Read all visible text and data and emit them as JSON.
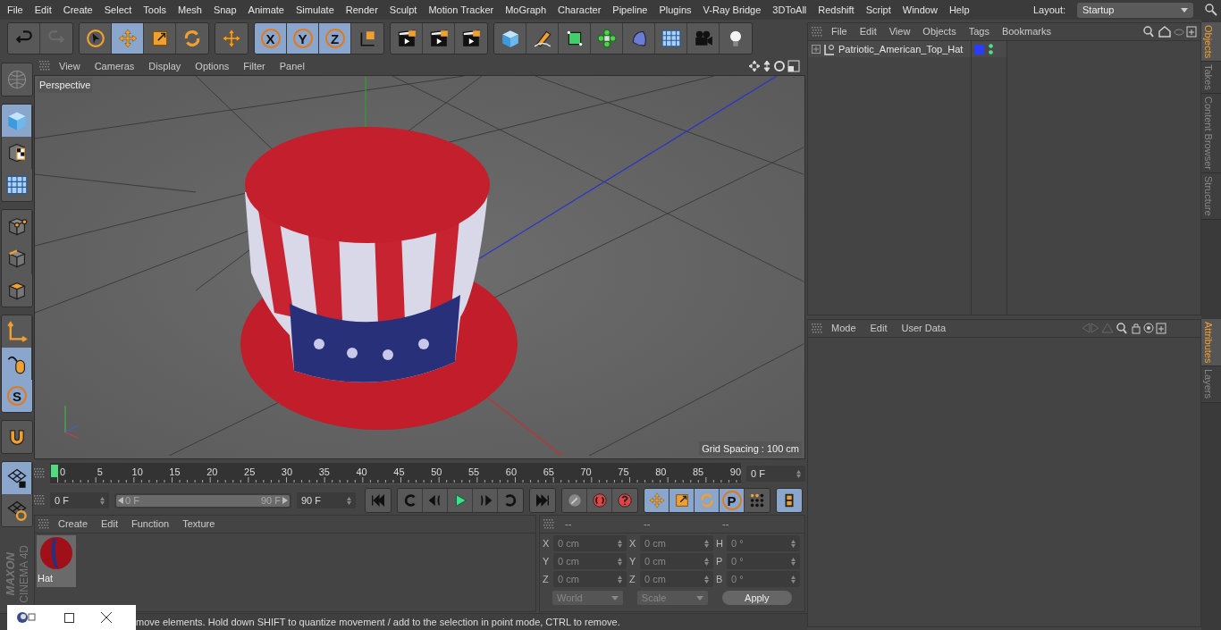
{
  "menu_bar": {
    "items": [
      "File",
      "Edit",
      "Create",
      "Select",
      "Tools",
      "Mesh",
      "Snap",
      "Animate",
      "Simulate",
      "Render",
      "Sculpt",
      "Motion Tracker",
      "MoGraph",
      "Character",
      "Pipeline",
      "Plugins",
      "V-Ray Bridge",
      "3DToAll",
      "Redshift",
      "Script",
      "Window",
      "Help"
    ],
    "layout_label": "Layout:",
    "layout_value": "Startup"
  },
  "toolbar": {
    "groups": [
      [
        {
          "kind": "undo",
          "selected": false
        },
        {
          "kind": "redo",
          "selected": false
        }
      ],
      [
        {
          "kind": "select",
          "selected": false
        },
        {
          "kind": "move",
          "selected": true
        },
        {
          "kind": "scale",
          "selected": false
        },
        {
          "kind": "rotate",
          "selected": false
        }
      ],
      [
        {
          "kind": "move",
          "selected": false
        }
      ],
      [
        {
          "kind": "letter",
          "label": "X",
          "selected": true
        },
        {
          "kind": "letter",
          "label": "Y",
          "selected": true
        },
        {
          "kind": "letter",
          "label": "Z",
          "selected": true
        },
        {
          "kind": "coord",
          "selected": false
        }
      ],
      [
        {
          "kind": "render",
          "selected": false
        },
        {
          "kind": "render",
          "selected": false
        },
        {
          "kind": "render",
          "selected": false
        }
      ],
      [
        {
          "kind": "cube",
          "selected": false
        },
        {
          "kind": "pen",
          "selected": false
        },
        {
          "kind": "subdiv",
          "selected": false
        },
        {
          "kind": "cloner",
          "selected": false
        },
        {
          "kind": "deformer",
          "selected": false
        },
        {
          "kind": "floor",
          "selected": false
        },
        {
          "kind": "camera",
          "selected": false
        },
        {
          "kind": "light",
          "selected": false
        }
      ]
    ]
  },
  "left_tools": {
    "groups": [
      [
        {
          "kind": "globe",
          "selected": false
        }
      ],
      [
        {
          "kind": "cube",
          "selected": true
        },
        {
          "kind": "texture",
          "selected": false
        },
        {
          "kind": "floor",
          "selected": false
        }
      ],
      [
        {
          "kind": "points",
          "selected": false
        },
        {
          "kind": "edges",
          "selected": false
        },
        {
          "kind": "polygons",
          "selected": false
        }
      ],
      [
        {
          "kind": "axis",
          "selected": false
        },
        {
          "kind": "mouse",
          "selected": true
        },
        {
          "kind": "letter",
          "label": "S",
          "selected": true
        }
      ],
      [
        {
          "kind": "magnet",
          "selected": false
        }
      ],
      [
        {
          "kind": "lockgrid",
          "selected": true
        },
        {
          "kind": "cyclegrid",
          "selected": false
        }
      ]
    ]
  },
  "logo": {
    "brand": "MAXON",
    "product": "CINEMA 4D"
  },
  "viewport": {
    "menu": [
      "View",
      "Cameras",
      "Display",
      "Options",
      "Filter",
      "Panel"
    ],
    "camera": "Perspective",
    "grid_spacing": "Grid Spacing : 100 cm"
  },
  "timeline": {
    "ticks": [
      "0",
      "5",
      "10",
      "15",
      "20",
      "25",
      "30",
      "35",
      "40",
      "45",
      "50",
      "55",
      "60",
      "65",
      "70",
      "75",
      "80",
      "85",
      "90"
    ],
    "current_frame": "0 F",
    "start": "0 F",
    "range": {
      "start": "0 F",
      "end": "90 F",
      "level": 1
    },
    "end": "90 F"
  },
  "transport": {
    "groups": [
      [
        {
          "kind": "to-start",
          "selected": false
        }
      ],
      [
        {
          "kind": "prev-key",
          "selected": false
        },
        {
          "kind": "prev-frame",
          "selected": false
        },
        {
          "kind": "play",
          "selected": false
        },
        {
          "kind": "next-frame",
          "selected": false
        },
        {
          "kind": "next-key",
          "selected": false
        }
      ],
      [
        {
          "kind": "to-end",
          "selected": false
        }
      ],
      [
        {
          "kind": "key-lock",
          "selected": false
        },
        {
          "kind": "record",
          "selected": false
        },
        {
          "kind": "help",
          "selected": false
        }
      ],
      [
        {
          "kind": "move",
          "selected": true
        },
        {
          "kind": "scale",
          "selected": true
        },
        {
          "kind": "rotate",
          "selected": true
        },
        {
          "kind": "letter",
          "label": "P",
          "selected": true
        },
        {
          "kind": "dots",
          "selected": false
        }
      ],
      [
        {
          "kind": "film",
          "selected": true
        }
      ]
    ]
  },
  "materials": {
    "menu": [
      "Create",
      "Edit",
      "Function",
      "Texture"
    ],
    "items": [
      {
        "name": "Hat"
      }
    ]
  },
  "coordinates": {
    "headers": [
      "--",
      "--",
      "--"
    ],
    "rows": [
      {
        "pos_axis": "X",
        "pos": "0 cm",
        "size_axis": "X",
        "size": "0 cm",
        "rot_axis": "H",
        "rot": "0 °"
      },
      {
        "pos_axis": "Y",
        "pos": "0 cm",
        "size_axis": "Y",
        "size": "0 cm",
        "rot_axis": "P",
        "rot": "0 °"
      },
      {
        "pos_axis": "Z",
        "pos": "0 cm",
        "size_axis": "Z",
        "size": "0 cm",
        "rot_axis": "B",
        "rot": "0 °"
      }
    ],
    "mode": "World",
    "size_mode": "Scale",
    "apply": "Apply"
  },
  "objects": {
    "menu": [
      "File",
      "Edit",
      "View",
      "Objects",
      "Tags",
      "Bookmarks"
    ],
    "items": [
      {
        "name": "Patriotic_American_Top_Hat",
        "color": "#2a3cff"
      }
    ]
  },
  "attributes": {
    "menu": [
      "Mode",
      "Edit",
      "User Data"
    ]
  },
  "side_tabs_top": [
    {
      "label": "Objects",
      "selected": true
    },
    {
      "label": "Takes",
      "selected": false
    },
    {
      "label": "Content Browser",
      "selected": false
    },
    {
      "label": "Structure",
      "selected": false
    }
  ],
  "side_tabs_bottom": [
    {
      "label": "Attributes",
      "selected": true
    },
    {
      "label": "Layers",
      "selected": false
    }
  ],
  "status_bar": "move elements. Hold down SHIFT to quantize movement / add to the selection in point mode, CTRL to remove."
}
